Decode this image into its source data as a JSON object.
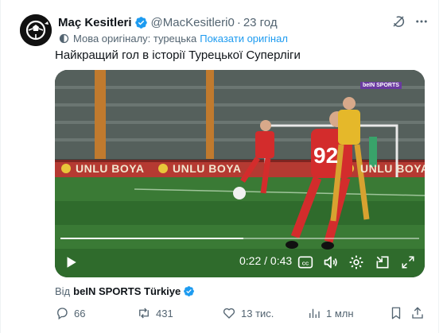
{
  "tweet": {
    "author_name": "Maç Kesitleri",
    "handle": "@MacKesitleri0",
    "separator": "·",
    "time": "23 год",
    "translation_note": "Мова оригіналу: турецька",
    "show_original": "Показати оригінал",
    "text": "Найкращий гол в історії Турецької Суперліги"
  },
  "video": {
    "banner_text": "UNLU BOYA",
    "channel_logo": "beIN SPORTS",
    "jersey_number": "92",
    "current_time": "0:22",
    "duration": "0:43",
    "time_separator": " / ",
    "progress": 0.51,
    "cc_label": "CC"
  },
  "source": {
    "prefix": "Від",
    "name": "beIN SPORTS Türkiye"
  },
  "actions": {
    "replies": "66",
    "reposts": "431",
    "likes": "13 тис.",
    "views": "1 млн"
  },
  "colors": {
    "verified": "#1d9bf0",
    "link": "#1d9bf0",
    "secondary_text": "#536471",
    "primary_text": "#0f1419"
  },
  "icons": [
    "grok-icon",
    "more-icon",
    "translate-icon",
    "play-icon",
    "captions-icon",
    "volume-icon",
    "settings-icon",
    "pip-icon",
    "fullscreen-icon",
    "reply-icon",
    "repost-icon",
    "like-icon",
    "views-icon",
    "bookmark-icon",
    "share-icon"
  ]
}
